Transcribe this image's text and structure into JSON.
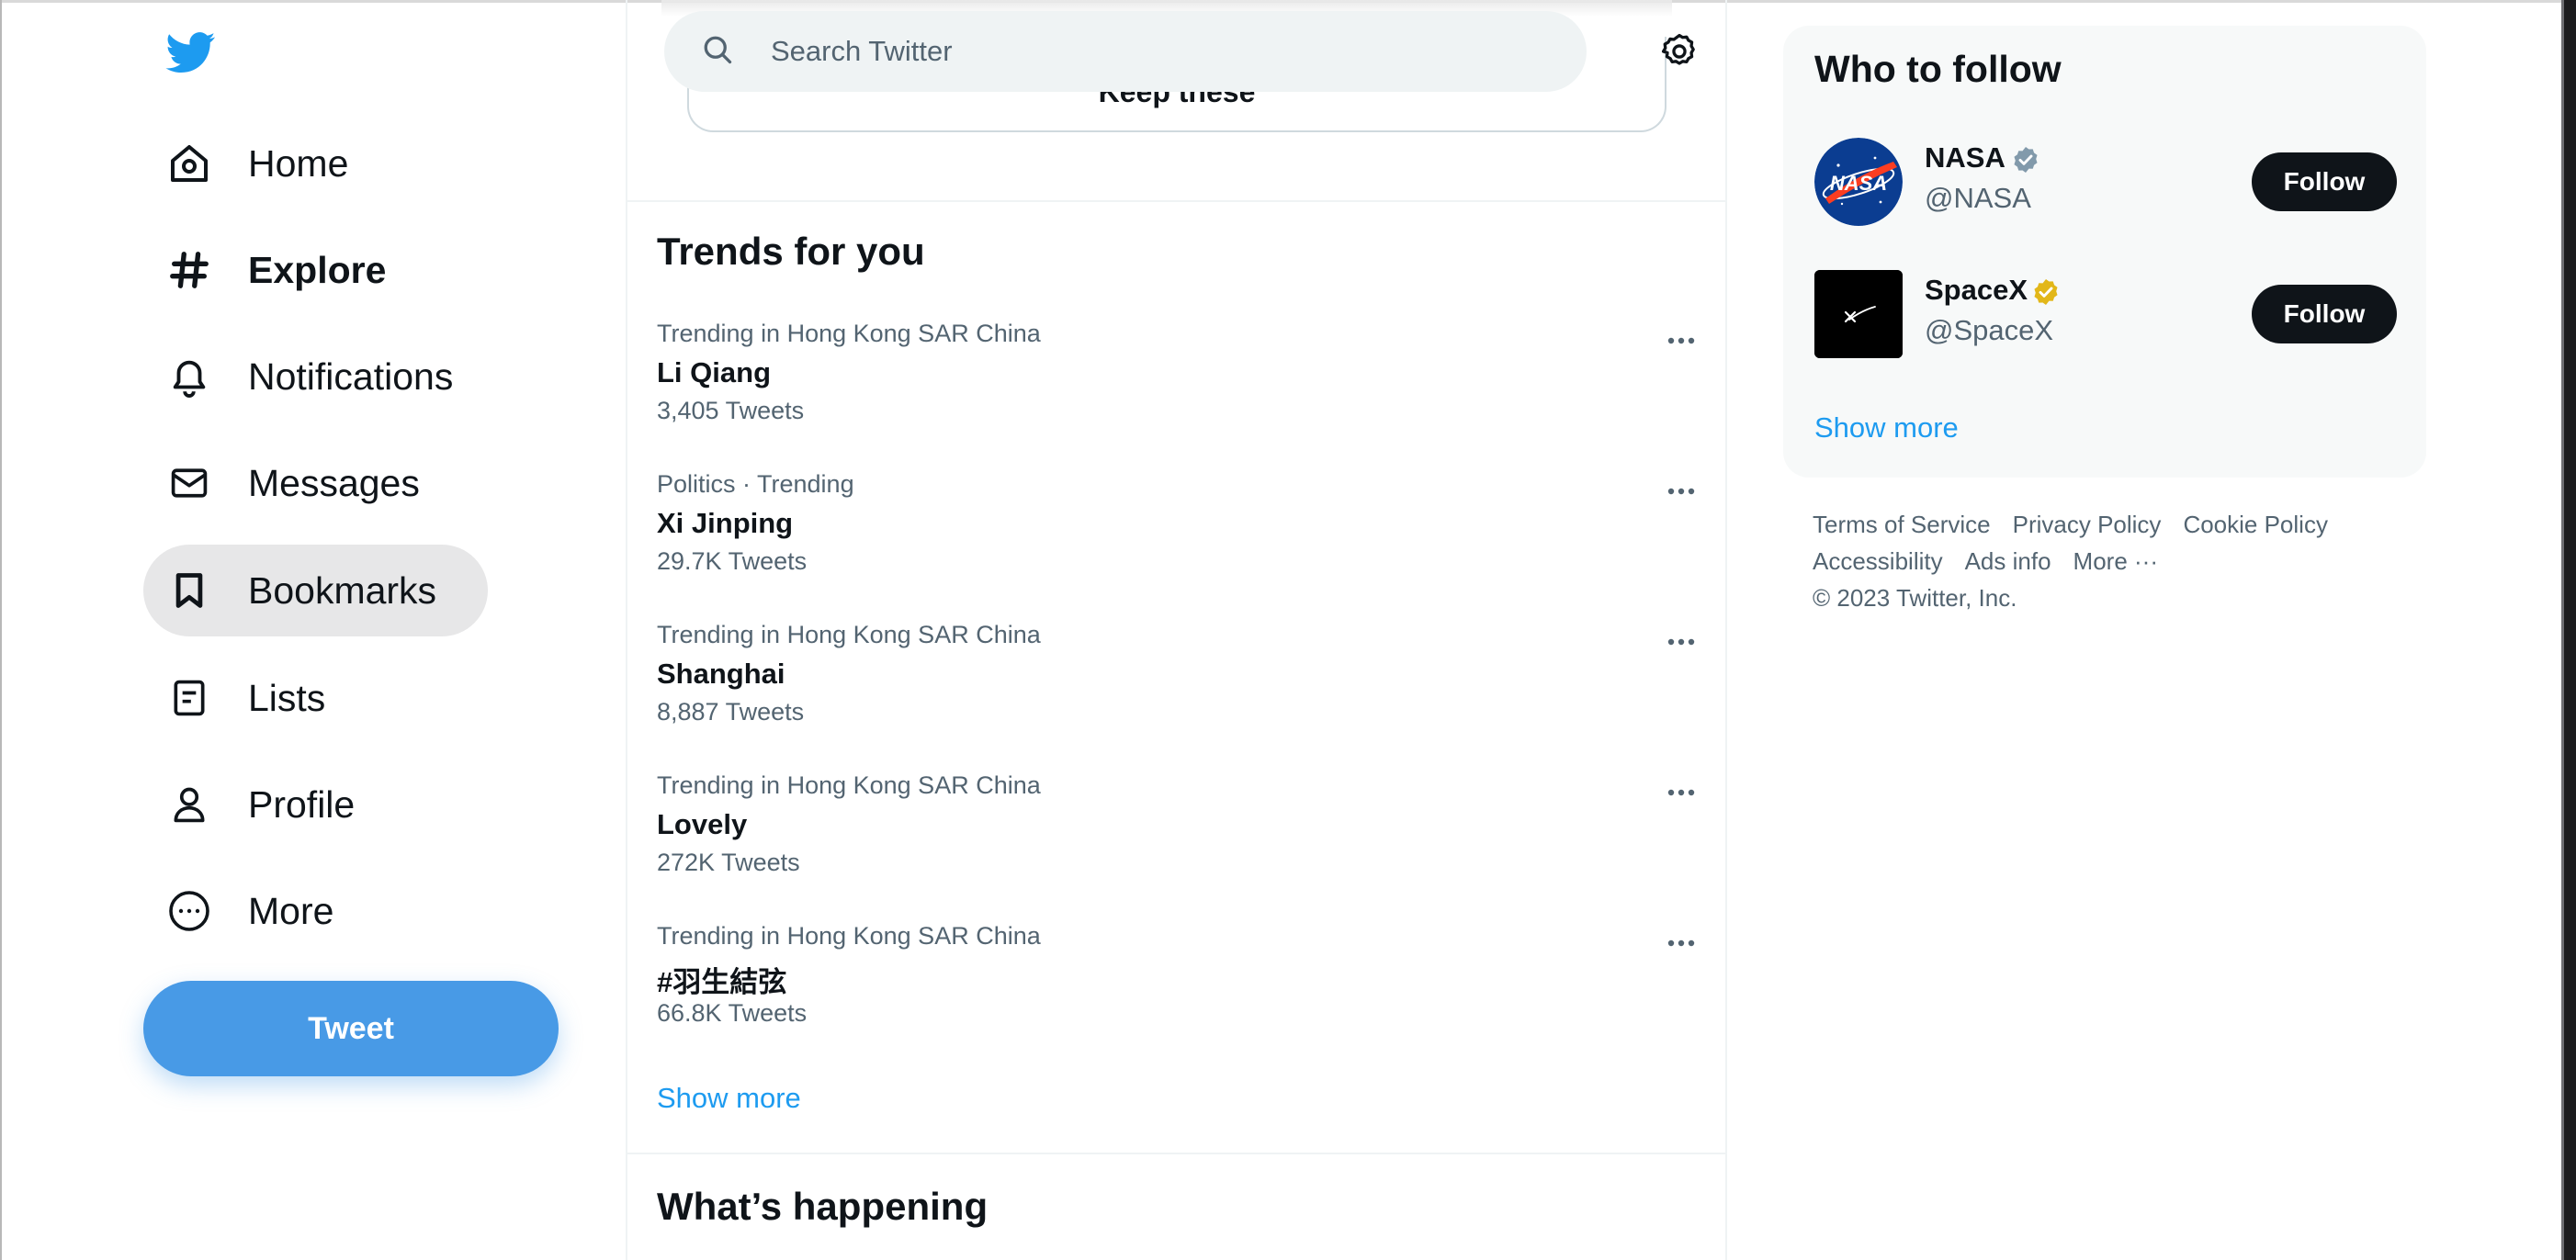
{
  "sidebar": {
    "logo": "twitter-bird-logo",
    "items": [
      {
        "label": "Home",
        "icon": "home-icon"
      },
      {
        "label": "Explore",
        "icon": "hashtag-icon"
      },
      {
        "label": "Notifications",
        "icon": "bell-icon"
      },
      {
        "label": "Messages",
        "icon": "envelope-icon"
      },
      {
        "label": "Bookmarks",
        "icon": "bookmark-icon"
      },
      {
        "label": "Lists",
        "icon": "list-icon"
      },
      {
        "label": "Profile",
        "icon": "person-icon"
      },
      {
        "label": "More",
        "icon": "more-circle-icon"
      }
    ],
    "tweet_label": "Tweet"
  },
  "search": {
    "placeholder": "Search Twitter"
  },
  "keep_card": {
    "label": "Keep these"
  },
  "trends": {
    "title": "Trends for you",
    "items": [
      {
        "context": "Trending in Hong Kong SAR China",
        "name": "Li Qiang",
        "count": "3,405 Tweets"
      },
      {
        "context": "Politics · Trending",
        "name": "Xi Jinping",
        "count": "29.7K Tweets"
      },
      {
        "context": "Trending in Hong Kong SAR China",
        "name": "Shanghai",
        "count": "8,887 Tweets"
      },
      {
        "context": "Trending in Hong Kong SAR China",
        "name": "Lovely",
        "count": "272K Tweets"
      },
      {
        "context": "Trending in Hong Kong SAR China",
        "name": "#羽生結弦",
        "count": "66.8K Tweets"
      }
    ],
    "show_more": "Show more"
  },
  "whats_happening": {
    "title": "What’s happening"
  },
  "who_to_follow": {
    "title": "Who to follow",
    "users": [
      {
        "name": "NASA",
        "handle": "@NASA",
        "badge": "verified-gray",
        "follow_label": "Follow"
      },
      {
        "name": "SpaceX",
        "handle": "@SpaceX",
        "badge": "verified-gold",
        "follow_label": "Follow"
      }
    ],
    "show_more": "Show more"
  },
  "footer": {
    "links": [
      "Terms of Service",
      "Privacy Policy",
      "Cookie Policy",
      "Accessibility",
      "Ads info",
      "More ···"
    ],
    "copyright": "© 2023 Twitter, Inc."
  },
  "colors": {
    "accent": "#1d9bf0",
    "tweet_button": "#489ae6",
    "text": "#0f1419",
    "secondary_text": "#536471"
  }
}
